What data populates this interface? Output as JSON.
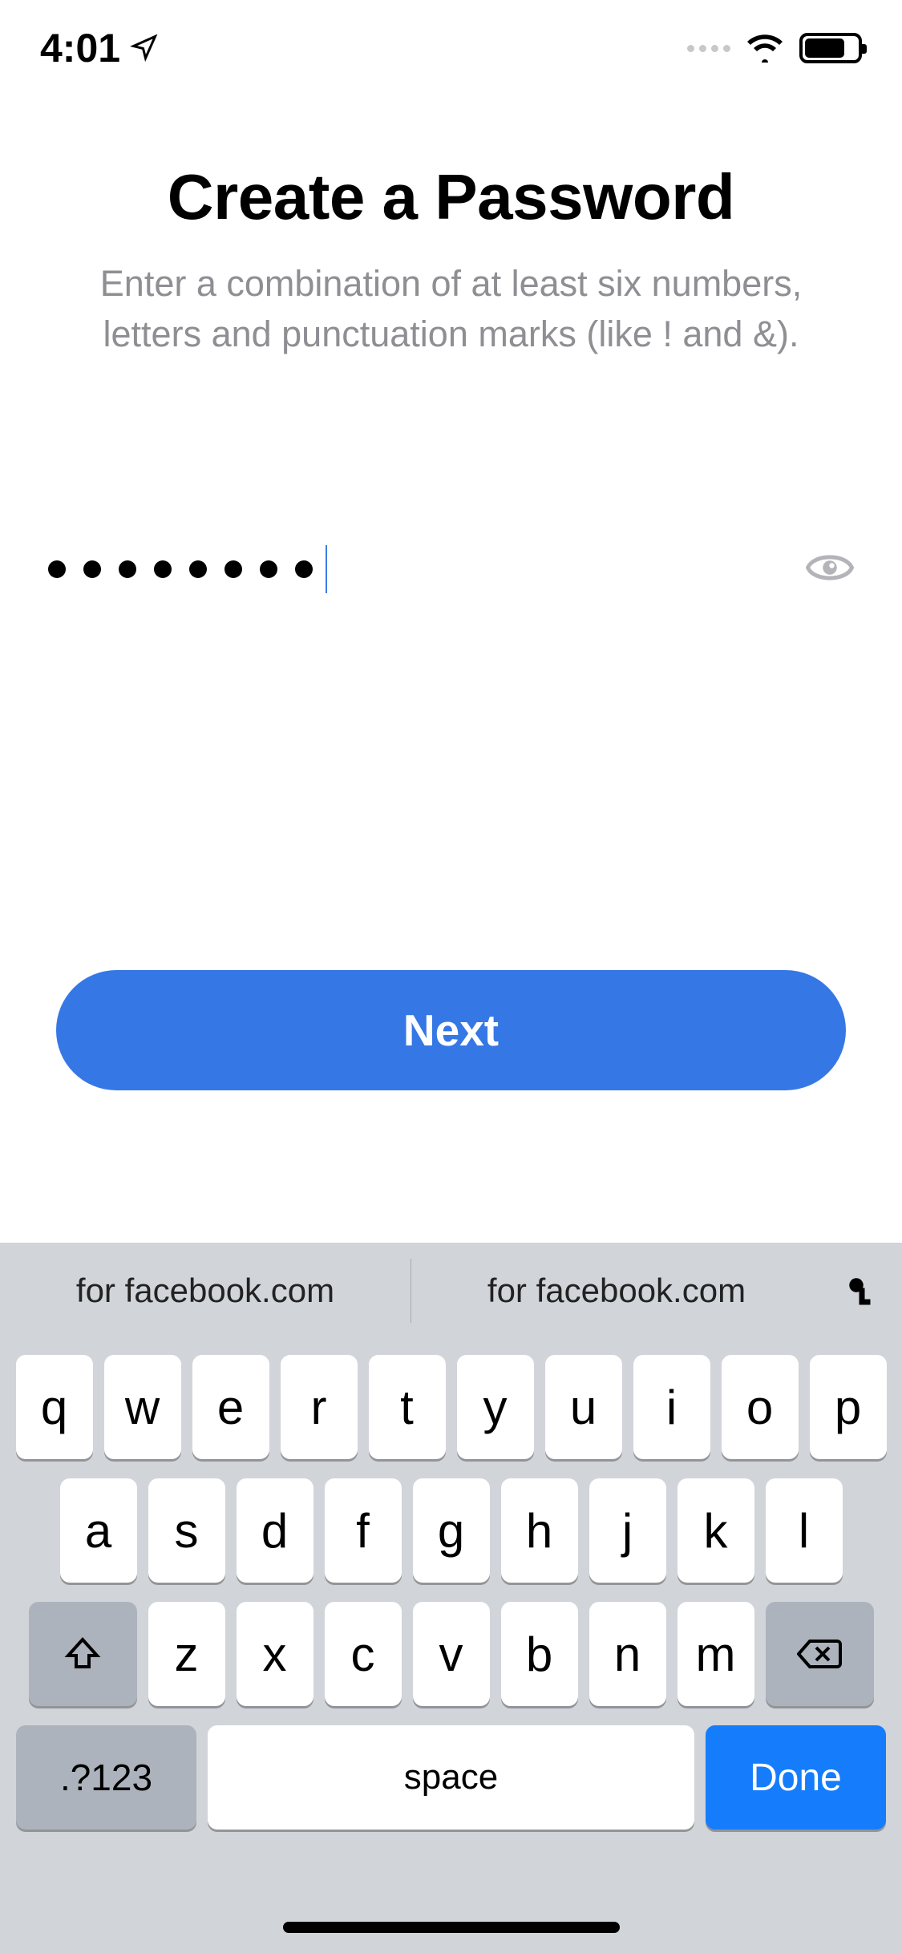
{
  "status_bar": {
    "time": "4:01"
  },
  "page": {
    "title": "Create a Password",
    "subtitle": "Enter a combination of at least six numbers, letters and punctuation marks (like ! and &).",
    "password_length": 8,
    "next_button": "Next"
  },
  "keyboard": {
    "suggestions": [
      "for facebook.com",
      "for facebook.com"
    ],
    "row1": [
      "q",
      "w",
      "e",
      "r",
      "t",
      "y",
      "u",
      "i",
      "o",
      "p"
    ],
    "row2": [
      "a",
      "s",
      "d",
      "f",
      "g",
      "h",
      "j",
      "k",
      "l"
    ],
    "row3": [
      "z",
      "x",
      "c",
      "v",
      "b",
      "n",
      "m"
    ],
    "numbers_key": ".?123",
    "space_key": "space",
    "done_key": "Done"
  }
}
